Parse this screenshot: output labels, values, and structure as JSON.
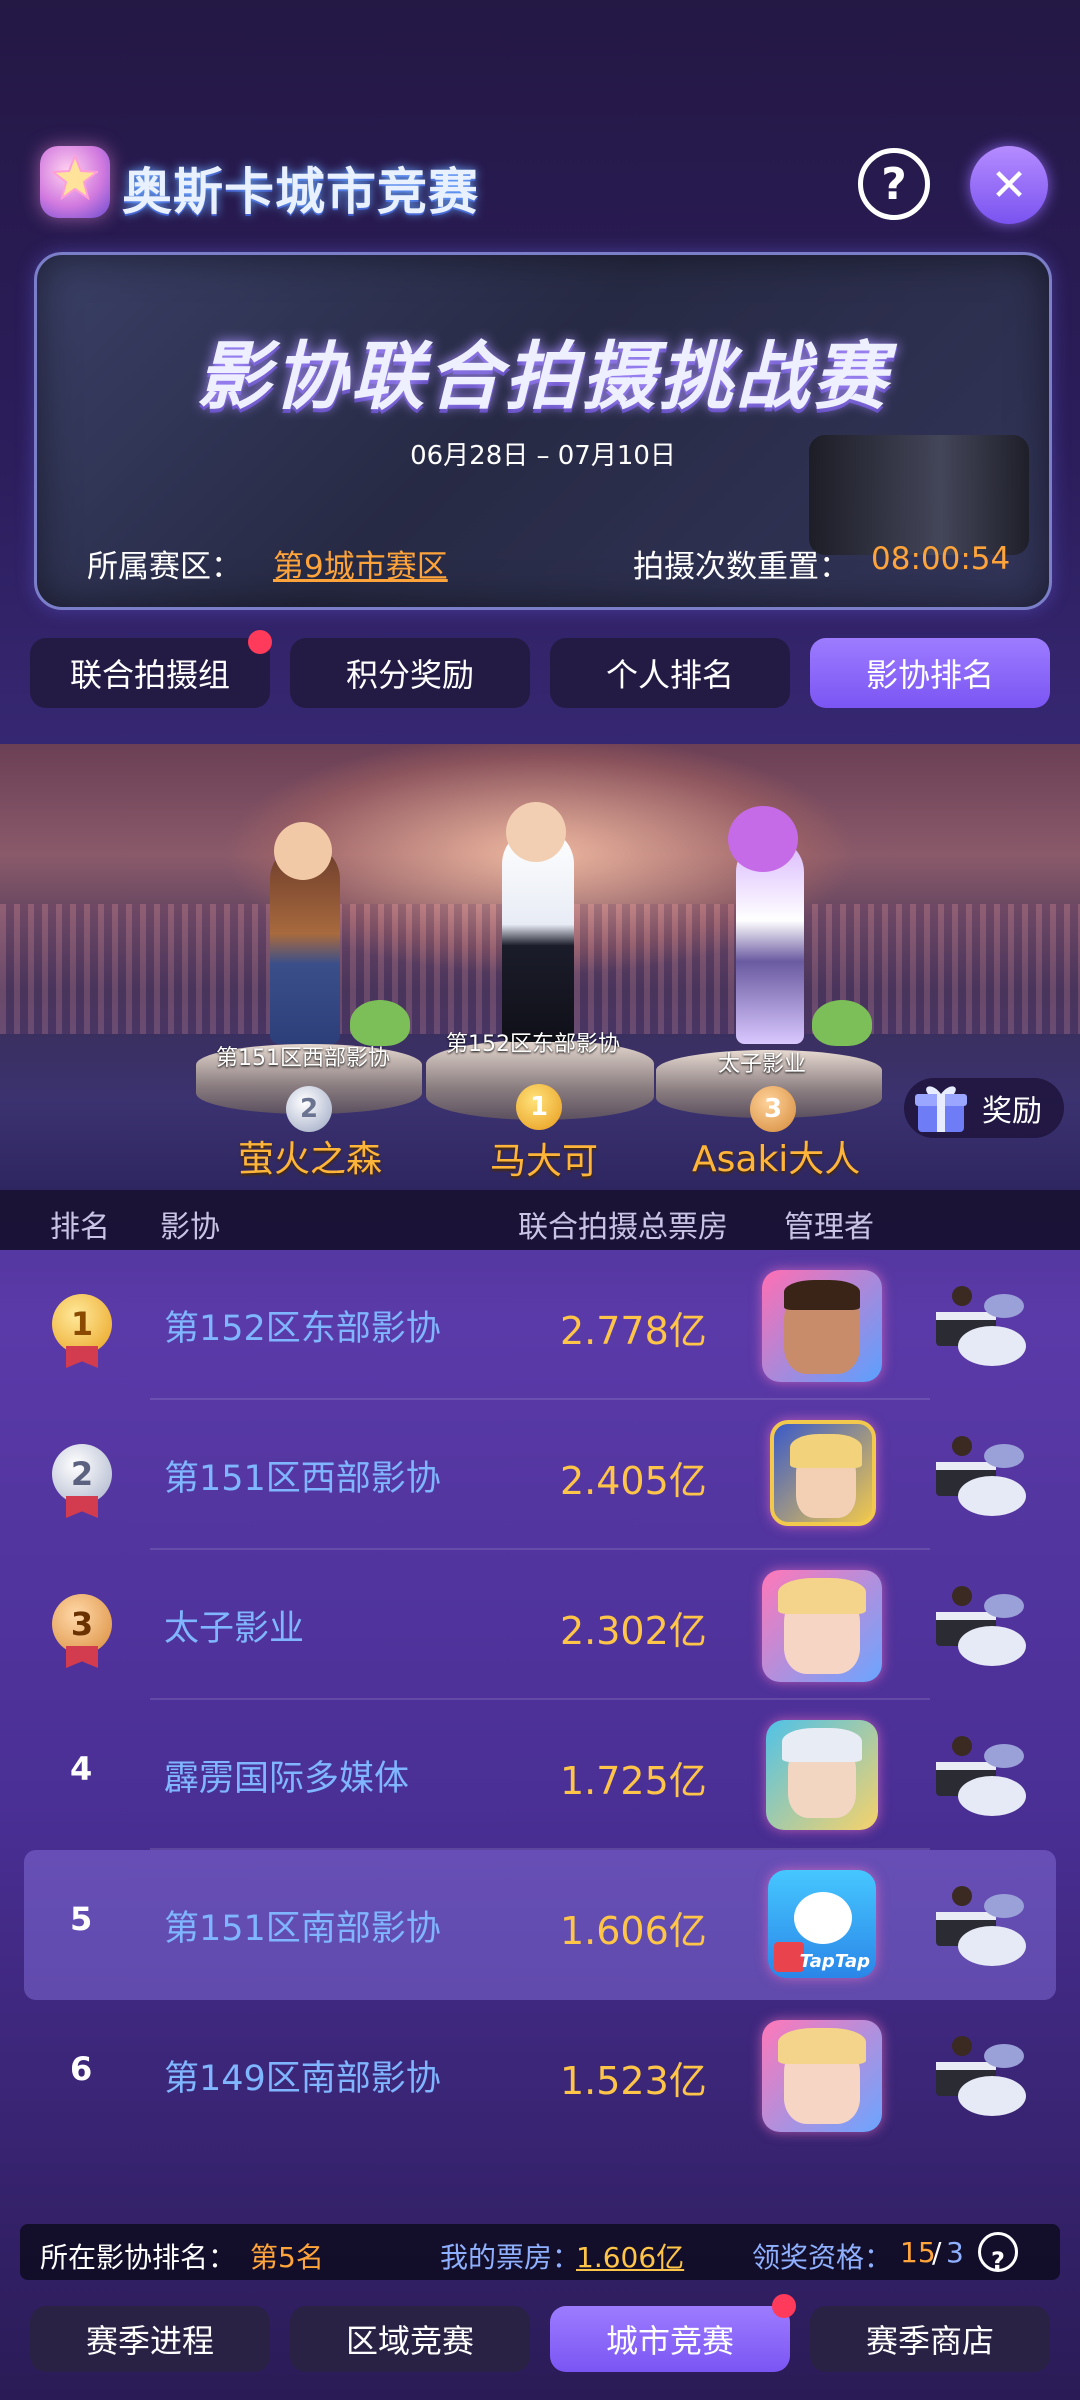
{
  "header": {
    "title": "奥斯卡城市竞赛",
    "help_icon": "question-icon",
    "close_icon": "close-icon"
  },
  "banner": {
    "title": "影协联合拍摄挑战赛",
    "dates": "06月28日 – 07月10日",
    "region_label": "所属赛区：",
    "region_value": "第9城市赛区",
    "reset_label": "拍摄次数重置：",
    "reset_value": "08:00:54"
  },
  "tabs": [
    {
      "label": "联合拍摄组",
      "has_badge": true
    },
    {
      "label": "积分奖励"
    },
    {
      "label": "个人排名"
    },
    {
      "label": "影协排名",
      "active": true
    }
  ],
  "podium": {
    "second": {
      "association": "第151区西部影协",
      "medal": "2",
      "player": "萤火之森"
    },
    "first": {
      "association": "第152区东部影协",
      "medal": "1",
      "player": "马大可"
    },
    "third": {
      "association": "太子影业",
      "medal": "3",
      "player": "Asaki大人"
    },
    "reward_label": "奖励"
  },
  "table": {
    "headers": {
      "rank": "排名",
      "association": "影协",
      "box_office": "联合拍摄总票房",
      "manager": "管理者"
    },
    "rows": [
      {
        "rank": "1",
        "association": "第152区东部影协",
        "box_office": "2.778亿"
      },
      {
        "rank": "2",
        "association": "第151区西部影协",
        "box_office": "2.405亿"
      },
      {
        "rank": "3",
        "association": "太子影业",
        "box_office": "2.302亿"
      },
      {
        "rank": "4",
        "association": "霹雳国际多媒体",
        "box_office": "1.725亿"
      },
      {
        "rank": "5",
        "association": "第151区南部影协",
        "box_office": "1.606亿",
        "highlighted": true
      },
      {
        "rank": "6",
        "association": "第149区南部影协",
        "box_office": "1.523亿"
      }
    ],
    "avatar_badge": "TapTap"
  },
  "info_bar": {
    "my_rank_label": "所在影协排名：",
    "my_rank_value": "第5名",
    "my_box_label": "我的票房：",
    "my_box_value": "1.606亿",
    "eligibility_label": "领奖资格：",
    "eligibility_current": "15",
    "eligibility_sep": "/",
    "eligibility_required": "3"
  },
  "bottom_nav": [
    {
      "label": "赛季进程"
    },
    {
      "label": "区域竞赛"
    },
    {
      "label": "城市竞赛",
      "active": true,
      "has_badge": true
    },
    {
      "label": "赛季商店"
    }
  ],
  "colors": {
    "accent": "#8a66ff",
    "highlight_text": "#ffa43a",
    "association_text": "#7fb6ff",
    "box_office_text": "#ffc548"
  }
}
